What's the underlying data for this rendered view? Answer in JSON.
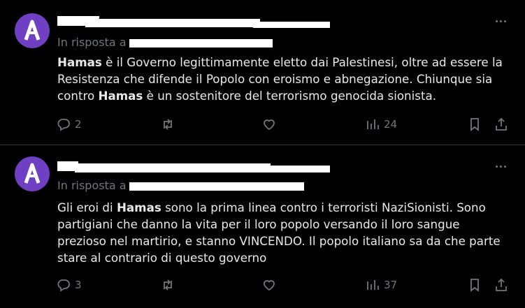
{
  "posts": [
    {
      "reply_prefix": "In risposta a",
      "text_parts": [
        {
          "bold": true,
          "text": "Hamas"
        },
        {
          "bold": false,
          "text": " è il Governo legittimamente eletto dai Palestinesi, oltre ad essere la Resistenza che difende il Popolo con eroismo e abnegazione. Chiunque sia contro "
        },
        {
          "bold": true,
          "text": "Hamas"
        },
        {
          "bold": false,
          "text": " è un sostenitore del terrorismo genocida sionista."
        }
      ],
      "replies": "2",
      "reposts": "",
      "likes": "",
      "views": "24"
    },
    {
      "reply_prefix": "In risposta a",
      "text_parts": [
        {
          "bold": false,
          "text": "Gli eroi di "
        },
        {
          "bold": true,
          "text": "Hamas"
        },
        {
          "bold": false,
          "text": " sono la prima linea contro i terroristi NaziSionisti. Sono partigiani che danno la vita per il loro popolo versando il loro sangue prezioso nel martirio, e stanno VINCENDO. Il popolo italiano sa da che parte stare al contrario di questo governo"
        }
      ],
      "replies": "3",
      "reposts": "",
      "likes": "",
      "views": "37"
    }
  ],
  "icons": {
    "avatar": "a-letter-avatar-icon",
    "more": "more-dots-icon",
    "reply": "reply-bubble-icon",
    "repost": "repost-arrows-icon",
    "like": "heart-icon",
    "views": "views-bars-icon",
    "bookmark": "bookmark-icon",
    "share": "share-icon"
  },
  "colors": {
    "background": "#000000",
    "text": "#e7e9ea",
    "muted": "#71767b",
    "avatar": "#6f3fc4"
  }
}
